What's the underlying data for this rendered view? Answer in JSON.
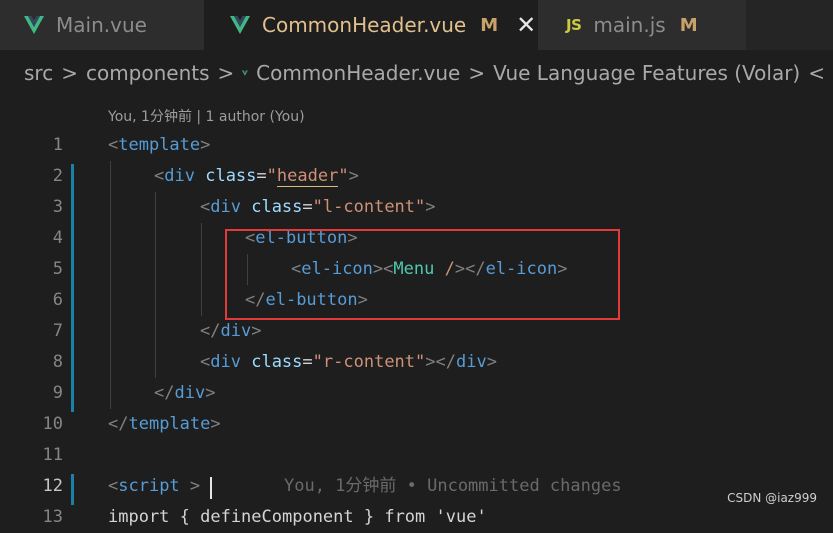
{
  "tabs": [
    {
      "label": "Main.vue",
      "icon": "vue-icon",
      "modified": "",
      "active": false
    },
    {
      "label": "CommonHeader.vue",
      "icon": "vue-icon",
      "modified": "M",
      "active": true
    },
    {
      "label": "main.js",
      "icon": "js-icon",
      "modified": "M",
      "active": false
    }
  ],
  "js_icon_text": "JS",
  "close_glyph": "✕",
  "breadcrumb": {
    "items": [
      "src",
      "components",
      "CommonHeader.vue",
      "Vue Language Features (Volar)"
    ],
    "sep": ">",
    "more": "<"
  },
  "codelens": "You, 1分钟前 | 1 author (You)",
  "lines": [
    {
      "num": "1"
    },
    {
      "num": "2"
    },
    {
      "num": "3"
    },
    {
      "num": "4"
    },
    {
      "num": "5"
    },
    {
      "num": "6"
    },
    {
      "num": "7"
    },
    {
      "num": "8"
    },
    {
      "num": "9"
    },
    {
      "num": "10"
    },
    {
      "num": "11"
    },
    {
      "num": "12"
    },
    {
      "num": "13"
    }
  ],
  "code": {
    "template": "template",
    "div": "div",
    "class": "class",
    "header": "header",
    "l_content": "l-content",
    "el_button": "el-button",
    "el_icon": "el-icon",
    "menu": "Menu",
    "r_content": "r-content",
    "script": "script",
    "ghost": "You, 1分钟前 • Uncommitted changes",
    "line13": "import { defineComponent } from 'vue'"
  },
  "watermark": "CSDN @iaz999",
  "colors": {
    "background": "#1e1e1e",
    "tag": "#569cd6",
    "attr": "#9cdcfe",
    "string": "#ce9178",
    "highlight_box": "#e03a3a"
  }
}
